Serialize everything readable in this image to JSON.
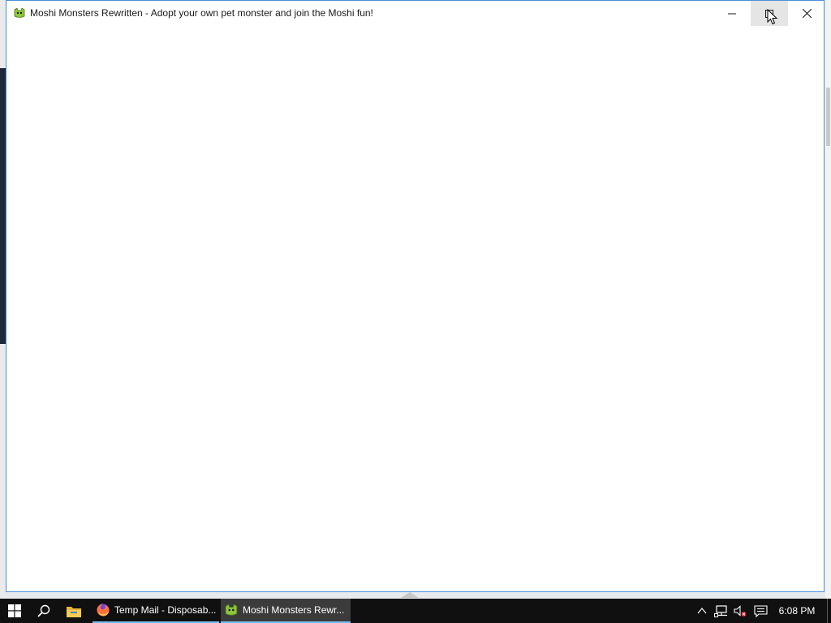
{
  "window": {
    "title": "Moshi Monsters Rewritten - Adopt your own pet monster and join the Moshi fun!",
    "icon": "moshi-app-icon",
    "controls": [
      "minimize-icon",
      "maximize-icon",
      "close-icon"
    ]
  },
  "taskbar": {
    "start_icon": "windows-start-icon",
    "search_icon": "search-icon",
    "explorer_icon": "file-explorer-icon",
    "apps": [
      {
        "label": "Temp Mail - Disposab...",
        "icon": "firefox-icon",
        "active": false
      },
      {
        "label": "Moshi Monsters Rewr...",
        "icon": "moshi-app-icon",
        "active": true
      }
    ],
    "tray": {
      "chevron_icon": "chevron-up-icon",
      "network_icon": "network-icon",
      "volume_icon": "volume-muted-icon",
      "notifications_icon": "action-center-icon",
      "clock": "6:08 PM"
    }
  },
  "colors": {
    "taskbar_bg": "#101010",
    "active_task_bg": "#3b3b3b",
    "task_underline": "#76b9ed",
    "window_border": "#4a90d9",
    "app_icon_green": "#8dc63f"
  }
}
